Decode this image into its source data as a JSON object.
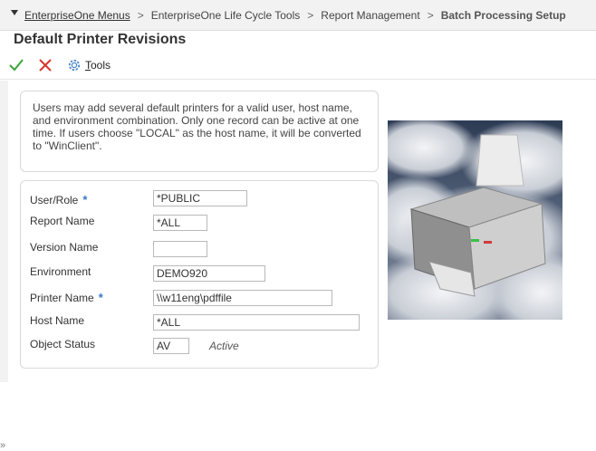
{
  "breadcrumb": {
    "items": [
      "EnterpriseOne Menus",
      "EnterpriseOne Life Cycle Tools",
      "Report Management",
      "Batch Processing Setup"
    ],
    "separator": ">"
  },
  "form": {
    "title": "Default Printer Revisions"
  },
  "toolbar": {
    "tools_label": "Tools",
    "tools_mnemonic": "T",
    "tools_rest": "ools"
  },
  "info": {
    "text": "Users may add several default printers for a valid user, host name, and environment combination. Only one record can be active at one time. If users choose \"LOCAL\" as the host name, it will be converted to \"WinClient\"."
  },
  "fields": {
    "user_role": {
      "label": "User/Role",
      "value": "*PUBLIC",
      "required": true
    },
    "report_name": {
      "label": "Report Name",
      "value": "*ALL"
    },
    "version_name": {
      "label": "Version Name",
      "value": ""
    },
    "environment": {
      "label": "Environment",
      "value": "DEMO920"
    },
    "printer_name": {
      "label": "Printer Name",
      "value": "\\\\w11eng\\pdffile",
      "required": true
    },
    "host_name": {
      "label": "Host Name",
      "value": "*ALL"
    },
    "object_status": {
      "label": "Object Status",
      "value": "AV",
      "description": "Active"
    }
  },
  "colors": {
    "required_marker": "#3a78c9",
    "ok": "#3aa53a",
    "cancel": "#d9342b"
  },
  "icons": {
    "ok": "checkmark-icon",
    "cancel": "x-icon",
    "tools": "gear-icon",
    "collapse": "caret-down-icon"
  }
}
